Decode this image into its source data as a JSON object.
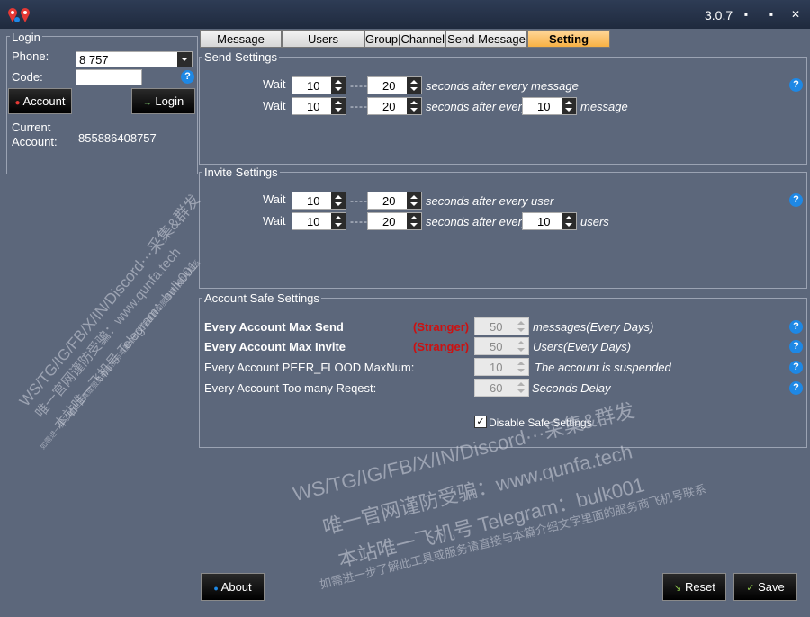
{
  "window": {
    "version": "3.0.7",
    "min": "▪",
    "max": "▪",
    "close": "✕"
  },
  "login": {
    "legend": "Login",
    "phone_label": "Phone:",
    "phone_value": "8          757",
    "code_label": "Code:",
    "account_btn": "Account",
    "login_btn": "Login",
    "current_label_1": "Current",
    "current_label_2": "Account:",
    "current_value": "855886408757"
  },
  "tabs": [
    "Message",
    "Users",
    "Group|Channel",
    "Send Message",
    "Setting"
  ],
  "send": {
    "legend": "Send Settings",
    "wait": "Wait",
    "row1": {
      "a": "10",
      "b": "20",
      "text": "seconds after every message"
    },
    "row2": {
      "a": "10",
      "b": "20",
      "text": "seconds after every",
      "c": "10",
      "text2": "message"
    }
  },
  "invite": {
    "legend": "Invite Settings",
    "wait": "Wait",
    "row1": {
      "a": "10",
      "b": "20",
      "text": "seconds after every user"
    },
    "row2": {
      "a": "10",
      "b": "20",
      "text": "seconds after every",
      "c": "10",
      "text2": "users"
    }
  },
  "safe": {
    "legend": "Account Safe Settings",
    "rows": [
      {
        "label": "Every Account Max Send",
        "tag": "(Stranger)",
        "value": "50",
        "suffix": "messages(Every Days)"
      },
      {
        "label": "Every Account Max Invite",
        "tag": "(Stranger)",
        "value": "50",
        "suffix": "Users(Every Days)"
      },
      {
        "label": "Every Account PEER_FLOOD MaxNum:",
        "value": "10",
        "suffix": "The account is suspended"
      },
      {
        "label": "Every Account Too many Reqest:",
        "value": "60",
        "suffix": "Seconds Delay"
      }
    ],
    "disable_label": "Disable Safe Settings",
    "disable_checked": "✓"
  },
  "footer": {
    "about": "About",
    "reset": "Reset",
    "save": "Save"
  },
  "watermark": {
    "line1": "WS/TG/IG/FB/X/IN/Discord···采集&群发",
    "line2": "唯一官网谨防受骗：www.qunfa.tech",
    "line3": "本站唯一飞机号 Telegram：bulk001",
    "line4": "如需进一步了解此工具或服务请直接与本篇介绍文字里面的服务商飞机号联系"
  }
}
